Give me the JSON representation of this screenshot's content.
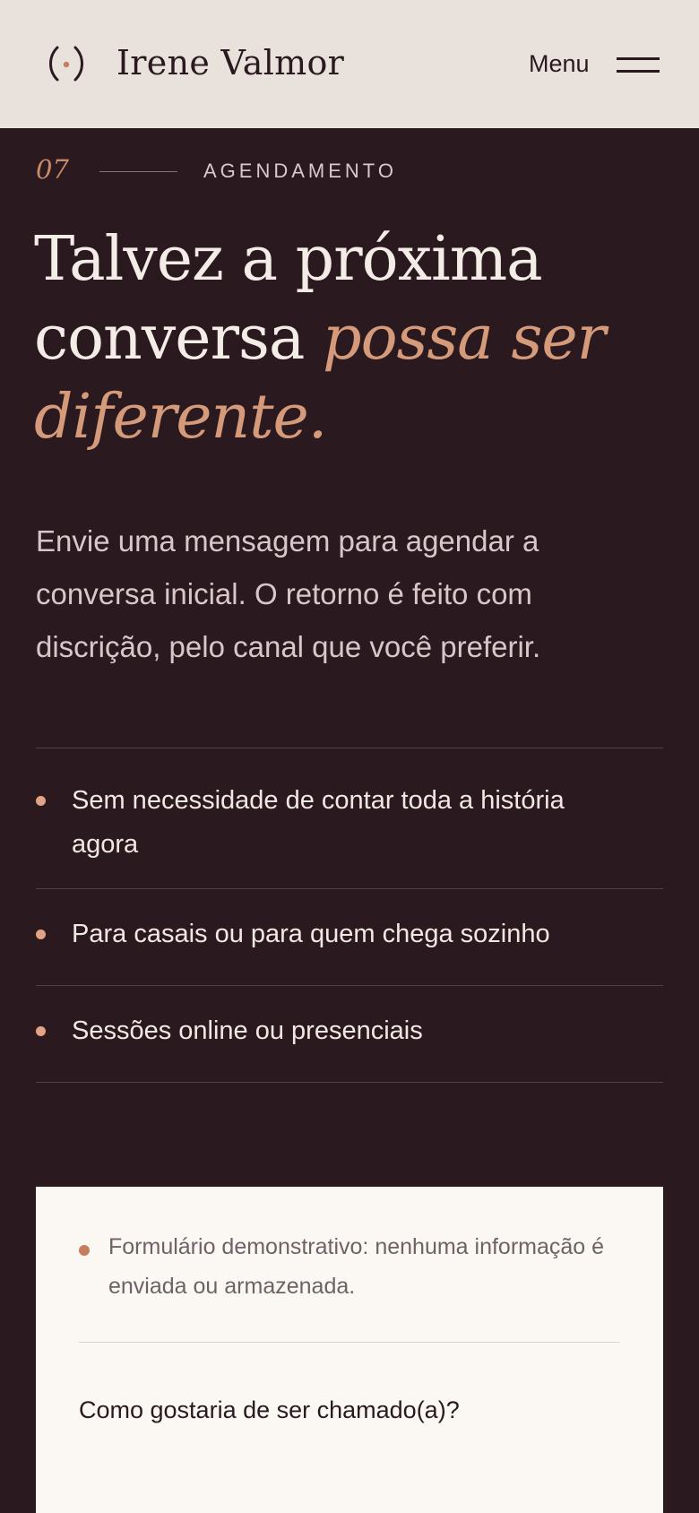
{
  "header": {
    "logo_icon": "parenthesis-dot-logo-icon",
    "brand": "Irene Valmor",
    "menu_label": "Menu",
    "menu_icon": "hamburger-icon"
  },
  "section": {
    "number": "07",
    "eyebrow": "AGENDAMENTO",
    "headline_part1": "Talvez a próxima conversa ",
    "headline_accent": "possa ser diferente.",
    "lead": "Envie uma mensagem para agendar a conversa inicial. O retorno é feito com discrição, pelo canal que você preferir."
  },
  "benefits": [
    {
      "label": "Sem necessidade de contar toda a história agora"
    },
    {
      "label": "Para casais ou para quem chega sozinho"
    },
    {
      "label": "Sessões online ou presenciais"
    }
  ],
  "form": {
    "notice": "Formulário demonstrativo: nenhuma informação é enviada ou armazenada.",
    "name_label": "Como gostaria de ser chamado(a)?"
  },
  "colors": {
    "background": "#2a1a20",
    "header_bg": "#e8e1dc",
    "accent": "#d59a7a",
    "card_bg": "#fbf8f3"
  }
}
